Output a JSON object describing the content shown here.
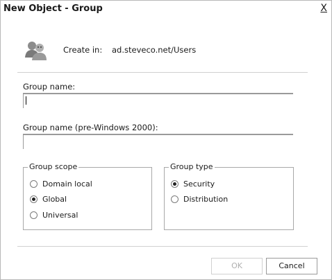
{
  "window": {
    "title": "New Object - Group",
    "close_label": "X"
  },
  "header": {
    "create_in_label": "Create in:",
    "create_in_path": "ad.steveco.net/Users",
    "icon": "group-users-icon"
  },
  "form": {
    "group_name_label": "Group name:",
    "group_name_value": "",
    "pre2000_label": "Group name (pre-Windows 2000):",
    "pre2000_value": ""
  },
  "scope": {
    "legend": "Group scope",
    "options": [
      {
        "label": "Domain local",
        "selected": false
      },
      {
        "label": "Global",
        "selected": true
      },
      {
        "label": "Universal",
        "selected": false
      }
    ]
  },
  "type": {
    "legend": "Group type",
    "options": [
      {
        "label": "Security",
        "selected": true
      },
      {
        "label": "Distribution",
        "selected": false
      }
    ]
  },
  "buttons": {
    "ok": "OK",
    "cancel": "Cancel"
  }
}
